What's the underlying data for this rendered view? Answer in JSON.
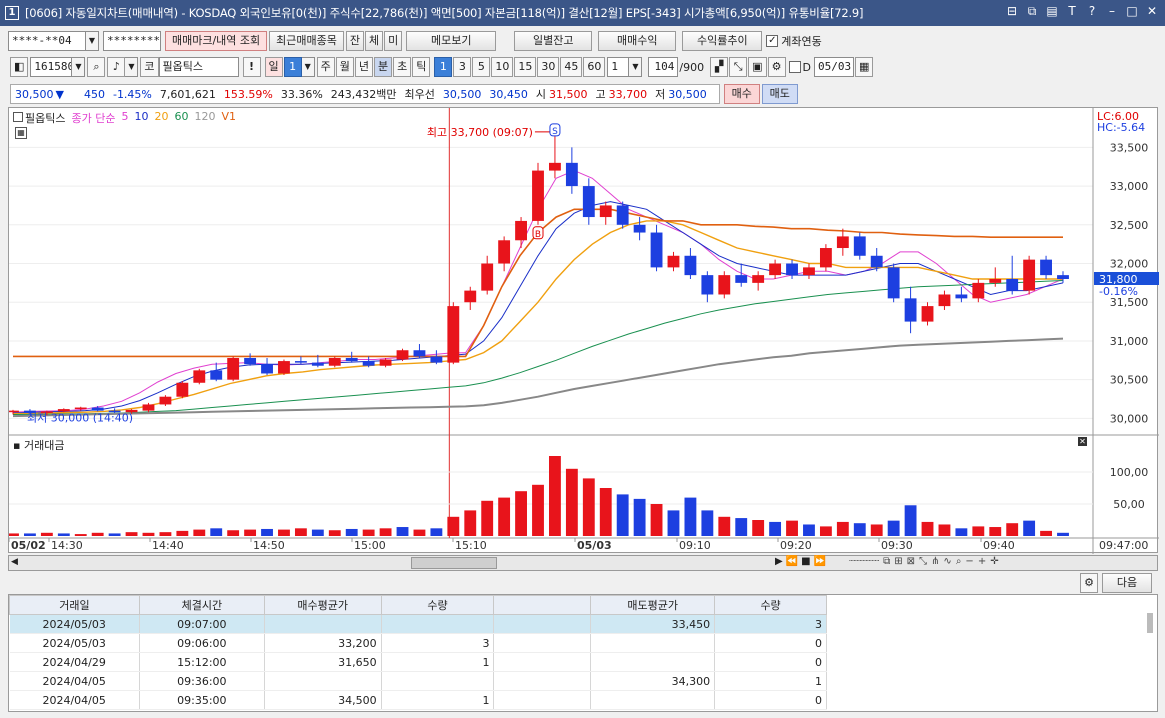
{
  "window": {
    "app_icon": "1",
    "title": "[0606] 자동일지차트(매매내역) - KOSDAQ 외국인보유[0(천)] 주식수[22,786(천)] 액면[500] 자본금[118(억)] 결산[12월] EPS[-343] 시가총액[6,950(억)] 유통비율[72.9]"
  },
  "toolbar1": {
    "account": "****-**04",
    "password": "********",
    "btn_trade_marks": "매매마크/내역 조회",
    "btn_recent": "최근매매종목",
    "btn_jan": "잔",
    "btn_che": "체",
    "btn_mi": "미",
    "btn_memo": "메모보기",
    "btn_daily_balance": "일별잔고",
    "btn_trade_profit": "매매수익",
    "btn_return_trend": "수익률추이",
    "account_link_label": "계좌연동"
  },
  "toolbar2": {
    "code": "161580",
    "market_tag": "코",
    "stock_name": "필옵틱스",
    "period_day": "일",
    "period_num": "1",
    "period_week": "주",
    "period_month": "월",
    "period_year": "년",
    "period_min": "분",
    "period_sec": "초",
    "period_tick": "틱",
    "intervals": [
      "1",
      "3",
      "5",
      "10",
      "15",
      "30",
      "45",
      "60"
    ],
    "interval_value": "1",
    "bars": "104",
    "bars_total": "/900",
    "d_label": "D",
    "date": "05/03"
  },
  "quote": {
    "price": "30,500",
    "change": "450",
    "change_pct": "-1.45%",
    "volume": "7,601,621",
    "vol_ratio": "153.59%",
    "turnover": "33.36%",
    "amount": "243,432백만",
    "best_bid_label": "최우선",
    "best_bid": "30,500",
    "best_ask": "30,450",
    "open_label": "시",
    "open": "31,500",
    "high_label": "고",
    "high": "33,700",
    "low_label": "저",
    "low": "30,500",
    "buy_label": "매수",
    "sell_label": "매도"
  },
  "legend": {
    "stock": "필옵틱스",
    "ma_label": "종가 단순",
    "ma_periods": [
      "5",
      "10",
      "20",
      "60",
      "120"
    ],
    "v1": "V1"
  },
  "price_axis": {
    "ticks": [
      "33,500",
      "33,000",
      "32,500",
      "32,000",
      "31,500",
      "31,000",
      "30,500",
      "30,000"
    ],
    "current": "31,800",
    "current_pct": "-0.16%",
    "lc": "LC:6.00",
    "hc": "HC:-5.64"
  },
  "volume_axis": {
    "title": "거래대금",
    "ticks": [
      "100,00",
      "50,00"
    ]
  },
  "annotations": {
    "high_text": "최고 33,700 (09:07)",
    "low_text": "최저 30,000 (14:40)",
    "buy_marker": "B",
    "sell_marker": "S"
  },
  "time_axis": {
    "labels": [
      "05/02",
      "14:30",
      "14:40",
      "14:50",
      "15:00",
      "15:10",
      "05/03",
      "09:10",
      "09:20",
      "09:30",
      "09:40"
    ],
    "end": "09:47:00"
  },
  "colors": {
    "up": "#e8141b",
    "down": "#1d3fe0",
    "ma5": "#e040d0",
    "ma10": "#1a2fc8",
    "ma20": "#f0a010",
    "ma60": "#1a9050",
    "ma120": "#888888",
    "v1": "#e06010"
  },
  "grid": {
    "next_label": "다음",
    "columns": [
      "거래일",
      "체결시간",
      "매수평균가",
      "수량",
      "",
      "매도평균가",
      "수량"
    ],
    "rows": [
      [
        "2024/05/03",
        "09:07:00",
        "",
        "",
        "",
        "33,450",
        "3"
      ],
      [
        "2024/05/03",
        "09:06:00",
        "33,200",
        "3",
        "",
        "",
        "0"
      ],
      [
        "2024/04/29",
        "15:12:00",
        "31,650",
        "1",
        "",
        "",
        "0"
      ],
      [
        "2024/04/05",
        "09:36:00",
        "",
        "",
        "",
        "34,300",
        "1"
      ],
      [
        "2024/04/05",
        "09:35:00",
        "34,500",
        "1",
        "",
        "",
        "0"
      ]
    ]
  },
  "chart_data": {
    "type": "line",
    "xlabel": "",
    "ylabel": "",
    "ylim": [
      29850,
      33750
    ],
    "series": [
      {
        "name": "5",
        "values": [
          30080,
          30090,
          30095,
          30100,
          30120,
          30160,
          30220,
          30330,
          30470,
          30580,
          30650,
          30700,
          30710,
          30720,
          30700,
          30690,
          30700,
          30720,
          30740,
          30760,
          30760,
          30780,
          30800,
          30820,
          30840,
          30850,
          31200,
          31700,
          32200,
          32700,
          33100,
          33200,
          33100,
          32900,
          32700,
          32600,
          32500,
          32400,
          32250,
          32050,
          31900,
          31800,
          31800,
          31850,
          31900,
          31900,
          31850,
          31900,
          32000,
          32150,
          32150,
          32000,
          31800,
          31600,
          31500,
          31550,
          31600,
          31700,
          31800
        ]
      },
      {
        "name": "10",
        "values": [
          30070,
          30080,
          30085,
          30090,
          30100,
          30120,
          30160,
          30230,
          30330,
          30440,
          30540,
          30610,
          30660,
          30690,
          30700,
          30700,
          30700,
          30710,
          30720,
          30730,
          30740,
          30750,
          30770,
          30790,
          30810,
          30830,
          31000,
          31300,
          31700,
          32100,
          32450,
          32650,
          32750,
          32800,
          32750,
          32700,
          32550,
          32400,
          32250,
          32100,
          32000,
          31950,
          31900,
          31850,
          31850,
          31850,
          31850,
          31900,
          31950,
          32000,
          32000,
          31900,
          31800,
          31700,
          31600,
          31650,
          31650,
          31700,
          31750
        ]
      },
      {
        "name": "20",
        "values": [
          30060,
          30065,
          30070,
          30075,
          30080,
          30090,
          30110,
          30140,
          30190,
          30250,
          30310,
          30380,
          30450,
          30500,
          30550,
          30580,
          30600,
          30630,
          30650,
          30670,
          30690,
          30700,
          30710,
          30720,
          30740,
          30760,
          30850,
          31000,
          31250,
          31500,
          31800,
          32050,
          32250,
          32400,
          32500,
          32550,
          32550,
          32500,
          32400,
          32300,
          32200,
          32150,
          32100,
          32050,
          32000,
          32000,
          31950,
          31950,
          31950,
          31950,
          31950,
          31900,
          31850,
          31800,
          31800,
          31800,
          31800,
          31800,
          31800
        ]
      },
      {
        "name": "60",
        "values": [
          30050,
          30052,
          30055,
          30058,
          30060,
          30065,
          30070,
          30080,
          30090,
          30100,
          30120,
          30140,
          30160,
          30180,
          30200,
          30220,
          30240,
          30260,
          30280,
          30300,
          30320,
          30340,
          30360,
          30380,
          30400,
          30420,
          30460,
          30520,
          30590,
          30670,
          30750,
          30840,
          30930,
          31010,
          31090,
          31160,
          31230,
          31290,
          31350,
          31400,
          31440,
          31480,
          31510,
          31540,
          31570,
          31600,
          31620,
          31640,
          31660,
          31680,
          31700,
          31710,
          31720,
          31730,
          31740,
          31750,
          31760,
          31770,
          31780
        ]
      },
      {
        "name": "120",
        "values": [
          30030,
          30035,
          30040,
          30045,
          30050,
          30055,
          30060,
          30065,
          30070,
          30075,
          30080,
          30085,
          30090,
          30095,
          30100,
          30105,
          30110,
          30115,
          30120,
          30125,
          30130,
          30135,
          30140,
          30145,
          30150,
          30155,
          30170,
          30200,
          30240,
          30280,
          30330,
          30380,
          30420,
          30460,
          30500,
          30540,
          30580,
          30620,
          30660,
          30700,
          30730,
          30760,
          30790,
          30810,
          30840,
          30860,
          30880,
          30900,
          30920,
          30940,
          30950,
          30960,
          30970,
          30980,
          30990,
          31000,
          31010,
          31020,
          31030
        ]
      },
      {
        "name": "V1",
        "values": [
          30800,
          30800,
          30800,
          30800,
          30800,
          30800,
          30800,
          30800,
          30800,
          30800,
          30800,
          30800,
          30800,
          30800,
          30800,
          30800,
          30800,
          30800,
          30800,
          30800,
          30800,
          30800,
          30800,
          30800,
          30800,
          30800,
          31200,
          31700,
          32100,
          32400,
          32600,
          32700,
          32700,
          32700,
          32650,
          32600,
          32550,
          32550,
          32500,
          32500,
          32500,
          32480,
          32470,
          32450,
          32450,
          32430,
          32420,
          32400,
          32400,
          32380,
          32370,
          32360,
          32350,
          32350,
          32340,
          32340,
          32340,
          32340,
          32340
        ]
      }
    ],
    "volume": [
      4,
      4,
      5,
      4,
      3,
      5,
      4,
      6,
      5,
      6,
      8,
      10,
      12,
      9,
      10,
      11,
      10,
      12,
      10,
      9,
      11,
      10,
      12,
      14,
      10,
      12,
      30,
      40,
      55,
      60,
      70,
      80,
      125,
      105,
      90,
      75,
      65,
      58,
      50,
      40,
      60,
      40,
      30,
      28,
      25,
      22,
      24,
      18,
      15,
      22,
      20,
      18,
      24,
      48,
      22,
      18,
      12,
      15,
      14,
      20,
      24,
      8,
      5
    ],
    "volume_up": [
      true,
      false,
      true,
      false,
      true,
      true,
      false,
      true,
      true,
      true,
      true,
      true,
      false,
      true,
      true,
      false,
      true,
      true,
      false,
      true,
      false,
      true,
      true,
      false,
      true,
      false,
      true,
      true,
      true,
      true,
      true,
      true,
      true,
      true,
      true,
      true,
      false,
      false,
      true,
      false,
      false,
      false,
      true,
      false,
      true,
      false,
      true,
      false,
      true,
      true,
      false,
      true,
      false,
      false,
      true,
      true,
      false,
      true,
      true,
      true,
      false,
      true,
      false
    ],
    "candles": [
      {
        "o": 30080,
        "h": 30110,
        "l": 30050,
        "c": 30100
      },
      {
        "o": 30100,
        "h": 30120,
        "l": 30060,
        "c": 30070
      },
      {
        "o": 30070,
        "h": 30100,
        "l": 30040,
        "c": 30090
      },
      {
        "o": 30090,
        "h": 30130,
        "l": 30080,
        "c": 30120
      },
      {
        "o": 30120,
        "h": 30150,
        "l": 30100,
        "c": 30140
      },
      {
        "o": 30140,
        "h": 30160,
        "l": 30090,
        "c": 30100
      },
      {
        "o": 30100,
        "h": 30130,
        "l": 30070,
        "c": 30080
      },
      {
        "o": 30080,
        "h": 30120,
        "l": 30060,
        "c": 30110
      },
      {
        "o": 30100,
        "h": 30200,
        "l": 30080,
        "c": 30180
      },
      {
        "o": 30180,
        "h": 30300,
        "l": 30160,
        "c": 30280
      },
      {
        "o": 30280,
        "h": 30480,
        "l": 30260,
        "c": 30460
      },
      {
        "o": 30460,
        "h": 30640,
        "l": 30440,
        "c": 30620
      },
      {
        "o": 30620,
        "h": 30720,
        "l": 30480,
        "c": 30500
      },
      {
        "o": 30500,
        "h": 30800,
        "l": 30480,
        "c": 30780
      },
      {
        "o": 30780,
        "h": 30840,
        "l": 30680,
        "c": 30700
      },
      {
        "o": 30700,
        "h": 30780,
        "l": 30560,
        "c": 30580
      },
      {
        "o": 30580,
        "h": 30760,
        "l": 30560,
        "c": 30740
      },
      {
        "o": 30740,
        "h": 30800,
        "l": 30700,
        "c": 30720
      },
      {
        "o": 30720,
        "h": 30820,
        "l": 30660,
        "c": 30680
      },
      {
        "o": 30680,
        "h": 30800,
        "l": 30660,
        "c": 30780
      },
      {
        "o": 30780,
        "h": 30860,
        "l": 30720,
        "c": 30740
      },
      {
        "o": 30740,
        "h": 30800,
        "l": 30660,
        "c": 30680
      },
      {
        "o": 30680,
        "h": 30780,
        "l": 30660,
        "c": 30760
      },
      {
        "o": 30760,
        "h": 30900,
        "l": 30740,
        "c": 30880
      },
      {
        "o": 30880,
        "h": 30960,
        "l": 30780,
        "c": 30800
      },
      {
        "o": 30800,
        "h": 30880,
        "l": 30700,
        "c": 30720
      },
      {
        "o": 30720,
        "h": 31500,
        "l": 30700,
        "c": 31450
      },
      {
        "o": 31500,
        "h": 31700,
        "l": 31400,
        "c": 31650
      },
      {
        "o": 31650,
        "h": 32100,
        "l": 31600,
        "c": 32000
      },
      {
        "o": 32000,
        "h": 32350,
        "l": 31900,
        "c": 32300
      },
      {
        "o": 32300,
        "h": 32600,
        "l": 32200,
        "c": 32550
      },
      {
        "o": 32550,
        "h": 33300,
        "l": 32500,
        "c": 33200
      },
      {
        "o": 33200,
        "h": 33700,
        "l": 33100,
        "c": 33300
      },
      {
        "o": 33300,
        "h": 33500,
        "l": 32900,
        "c": 33000
      },
      {
        "o": 33000,
        "h": 33100,
        "l": 32500,
        "c": 32600
      },
      {
        "o": 32600,
        "h": 32800,
        "l": 32500,
        "c": 32750
      },
      {
        "o": 32750,
        "h": 32800,
        "l": 32450,
        "c": 32500
      },
      {
        "o": 32500,
        "h": 32600,
        "l": 32300,
        "c": 32400
      },
      {
        "o": 32400,
        "h": 32500,
        "l": 31900,
        "c": 31950
      },
      {
        "o": 31950,
        "h": 32150,
        "l": 31900,
        "c": 32100
      },
      {
        "o": 32100,
        "h": 32200,
        "l": 31800,
        "c": 31850
      },
      {
        "o": 31850,
        "h": 31900,
        "l": 31500,
        "c": 31600
      },
      {
        "o": 31600,
        "h": 31900,
        "l": 31550,
        "c": 31850
      },
      {
        "o": 31850,
        "h": 32000,
        "l": 31700,
        "c": 31750
      },
      {
        "o": 31750,
        "h": 31900,
        "l": 31650,
        "c": 31850
      },
      {
        "o": 31850,
        "h": 32050,
        "l": 31800,
        "c": 32000
      },
      {
        "o": 32000,
        "h": 32050,
        "l": 31800,
        "c": 31850
      },
      {
        "o": 31850,
        "h": 32000,
        "l": 31800,
        "c": 31950
      },
      {
        "o": 31950,
        "h": 32250,
        "l": 31900,
        "c": 32200
      },
      {
        "o": 32200,
        "h": 32450,
        "l": 32100,
        "c": 32350
      },
      {
        "o": 32350,
        "h": 32400,
        "l": 32050,
        "c": 32100
      },
      {
        "o": 32100,
        "h": 32200,
        "l": 31900,
        "c": 31950
      },
      {
        "o": 31950,
        "h": 32000,
        "l": 31500,
        "c": 31550
      },
      {
        "o": 31550,
        "h": 31700,
        "l": 31100,
        "c": 31250
      },
      {
        "o": 31250,
        "h": 31500,
        "l": 31200,
        "c": 31450
      },
      {
        "o": 31450,
        "h": 31650,
        "l": 31400,
        "c": 31600
      },
      {
        "o": 31600,
        "h": 31700,
        "l": 31500,
        "c": 31550
      },
      {
        "o": 31550,
        "h": 31800,
        "l": 31500,
        "c": 31750
      },
      {
        "o": 31750,
        "h": 31950,
        "l": 31700,
        "c": 31800
      },
      {
        "o": 31800,
        "h": 32100,
        "l": 31600,
        "c": 31650
      },
      {
        "o": 31650,
        "h": 32100,
        "l": 31600,
        "c": 32050
      },
      {
        "o": 32050,
        "h": 32100,
        "l": 31800,
        "c": 31850
      },
      {
        "o": 31850,
        "h": 31900,
        "l": 31750,
        "c": 31800
      }
    ]
  }
}
